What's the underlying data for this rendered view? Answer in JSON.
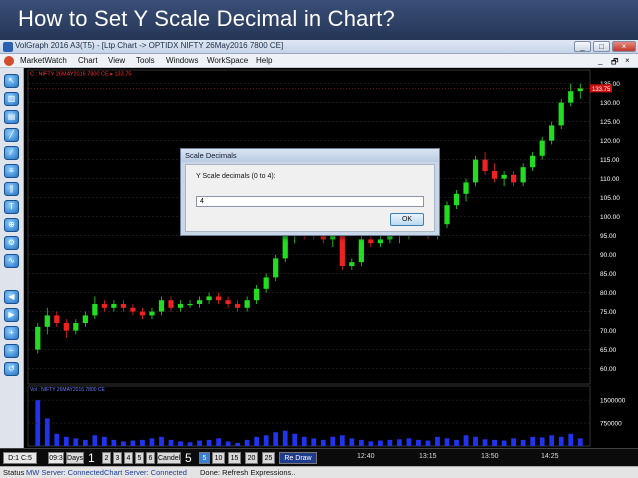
{
  "slide_title": "How to Set Y Scale Decimal in Chart?",
  "window": {
    "title": "VolGraph 2016 A3(T5) - [Ltp Chart -> OPTIDX  NIFTY  26May2016  7800  CE]",
    "controls": [
      "_",
      "□",
      "×"
    ]
  },
  "menu": {
    "items": [
      "MarketWatch",
      "Chart",
      "View",
      "Tools",
      "Windows",
      "WorkSpace",
      "Help"
    ],
    "mdi_controls": [
      "_",
      "🗗",
      "×"
    ]
  },
  "chart": {
    "header_text": "C : NIFTY  26MAY2016  7800  CE  ▸ 133.75",
    "last_price": "133.75",
    "price_ticks": [
      "135.00",
      "130.00",
      "125.00",
      "120.00",
      "115.00",
      "110.00",
      "105.00",
      "100.00",
      "95.00",
      "90.00",
      "85.00",
      "80.00",
      "75.00",
      "70.00",
      "65.00",
      "60.00"
    ],
    "volume_ticks": [
      "1500000",
      "750000"
    ],
    "volume_header": "Vol : NIFTY  26MAY2016  7800  CE",
    "colors": {
      "up": "#22dd22",
      "down": "#ee2222",
      "volume": "#2233ee",
      "grid": "#2a2a2a",
      "axis_text": "#ffffff"
    }
  },
  "chart_data": {
    "type": "candlestick",
    "y_range": [
      57,
      137
    ],
    "candles": [
      {
        "o": 65,
        "h": 72,
        "l": 64,
        "c": 71
      },
      {
        "o": 71,
        "h": 76,
        "l": 69,
        "c": 74
      },
      {
        "o": 74,
        "h": 75,
        "l": 71,
        "c": 72
      },
      {
        "o": 72,
        "h": 73,
        "l": 68,
        "c": 70
      },
      {
        "o": 70,
        "h": 73,
        "l": 69,
        "c": 72
      },
      {
        "o": 72,
        "h": 75,
        "l": 71,
        "c": 74
      },
      {
        "o": 74,
        "h": 79,
        "l": 73,
        "c": 77
      },
      {
        "o": 77,
        "h": 78,
        "l": 75,
        "c": 76
      },
      {
        "o": 76,
        "h": 78,
        "l": 75,
        "c": 77
      },
      {
        "o": 77,
        "h": 78,
        "l": 75,
        "c": 76
      },
      {
        "o": 76,
        "h": 77,
        "l": 74,
        "c": 75
      },
      {
        "o": 75,
        "h": 76,
        "l": 73,
        "c": 74
      },
      {
        "o": 74,
        "h": 76,
        "l": 73,
        "c": 75
      },
      {
        "o": 75,
        "h": 79,
        "l": 74,
        "c": 78
      },
      {
        "o": 78,
        "h": 79,
        "l": 75,
        "c": 76
      },
      {
        "o": 76,
        "h": 78,
        "l": 75,
        "c": 77
      },
      {
        "o": 77,
        "h": 78,
        "l": 76,
        "c": 77
      },
      {
        "o": 77,
        "h": 79,
        "l": 76,
        "c": 78
      },
      {
        "o": 78,
        "h": 80,
        "l": 77,
        "c": 79
      },
      {
        "o": 79,
        "h": 80,
        "l": 77,
        "c": 78
      },
      {
        "o": 78,
        "h": 79,
        "l": 76,
        "c": 77
      },
      {
        "o": 77,
        "h": 78,
        "l": 75,
        "c": 76
      },
      {
        "o": 76,
        "h": 79,
        "l": 75,
        "c": 78
      },
      {
        "o": 78,
        "h": 82,
        "l": 77,
        "c": 81
      },
      {
        "o": 81,
        "h": 85,
        "l": 80,
        "c": 84
      },
      {
        "o": 84,
        "h": 90,
        "l": 83,
        "c": 89
      },
      {
        "o": 89,
        "h": 96,
        "l": 88,
        "c": 95
      },
      {
        "o": 95,
        "h": 99,
        "l": 93,
        "c": 97
      },
      {
        "o": 97,
        "h": 99,
        "l": 94,
        "c": 96
      },
      {
        "o": 96,
        "h": 97,
        "l": 94,
        "c": 95
      },
      {
        "o": 95,
        "h": 96,
        "l": 93,
        "c": 94
      },
      {
        "o": 94,
        "h": 96,
        "l": 92,
        "c": 95
      },
      {
        "o": 95,
        "h": 96,
        "l": 86,
        "c": 87
      },
      {
        "o": 87,
        "h": 89,
        "l": 86,
        "c": 88
      },
      {
        "o": 88,
        "h": 95,
        "l": 87,
        "c": 94
      },
      {
        "o": 94,
        "h": 95,
        "l": 92,
        "c": 93
      },
      {
        "o": 93,
        "h": 95,
        "l": 92,
        "c": 94
      },
      {
        "o": 94,
        "h": 96,
        "l": 93,
        "c": 95
      },
      {
        "o": 95,
        "h": 97,
        "l": 93,
        "c": 96
      },
      {
        "o": 96,
        "h": 98,
        "l": 94,
        "c": 97
      },
      {
        "o": 97,
        "h": 99,
        "l": 95,
        "c": 98
      },
      {
        "o": 98,
        "h": 99,
        "l": 94,
        "c": 95
      },
      {
        "o": 95,
        "h": 99,
        "l": 94,
        "c": 98
      },
      {
        "o": 98,
        "h": 104,
        "l": 97,
        "c": 103
      },
      {
        "o": 103,
        "h": 107,
        "l": 102,
        "c": 106
      },
      {
        "o": 106,
        "h": 110,
        "l": 104,
        "c": 109
      },
      {
        "o": 109,
        "h": 116,
        "l": 108,
        "c": 115
      },
      {
        "o": 115,
        "h": 117,
        "l": 111,
        "c": 112
      },
      {
        "o": 112,
        "h": 114,
        "l": 109,
        "c": 110
      },
      {
        "o": 110,
        "h": 112,
        "l": 108,
        "c": 111
      },
      {
        "o": 111,
        "h": 112,
        "l": 108,
        "c": 109
      },
      {
        "o": 109,
        "h": 114,
        "l": 108,
        "c": 113
      },
      {
        "o": 113,
        "h": 117,
        "l": 112,
        "c": 116
      },
      {
        "o": 116,
        "h": 121,
        "l": 115,
        "c": 120
      },
      {
        "o": 120,
        "h": 125,
        "l": 119,
        "c": 124
      },
      {
        "o": 124,
        "h": 131,
        "l": 123,
        "c": 130
      },
      {
        "o": 130,
        "h": 135,
        "l": 129,
        "c": 133
      },
      {
        "o": 133,
        "h": 135,
        "l": 131,
        "c": 133.75
      }
    ],
    "volume": [
      1500000,
      900000,
      400000,
      300000,
      250000,
      200000,
      350000,
      300000,
      200000,
      150000,
      180000,
      200000,
      250000,
      300000,
      200000,
      150000,
      120000,
      180000,
      200000,
      250000,
      150000,
      100000,
      200000,
      300000,
      350000,
      450000,
      500000,
      400000,
      300000,
      250000,
      200000,
      300000,
      350000,
      250000,
      200000,
      150000,
      180000,
      200000,
      220000,
      250000,
      200000,
      180000,
      300000,
      250000,
      200000,
      350000,
      300000,
      220000,
      200000,
      180000,
      250000,
      200000,
      300000,
      280000,
      350000,
      300000,
      400000,
      250000
    ],
    "x_ticks": [
      "12:40",
      "13:15",
      "13:50",
      "14:25"
    ]
  },
  "dialog": {
    "title": "Scale Decimals",
    "label": "Y Scale decimals (0 to 4):",
    "value": "4",
    "ok_label": "OK"
  },
  "bottom": {
    "left_labels": [
      "D:1 C:5",
      "09:3"
    ],
    "days_label": "Days",
    "days_value": "1",
    "day_buttons": [
      "2",
      "3",
      "4",
      "5",
      "6"
    ],
    "candel_label": "Candel :",
    "candel_value": "5",
    "candel_buttons": [
      "5",
      "10",
      "15",
      "20",
      "25"
    ],
    "redraw_label": "Re Draw"
  },
  "status": {
    "label": "Status",
    "mw_server": "MW Server: Connected",
    "chart_server": "Chart Server: Connected",
    "done": "Done: Refresh Expressions.."
  }
}
